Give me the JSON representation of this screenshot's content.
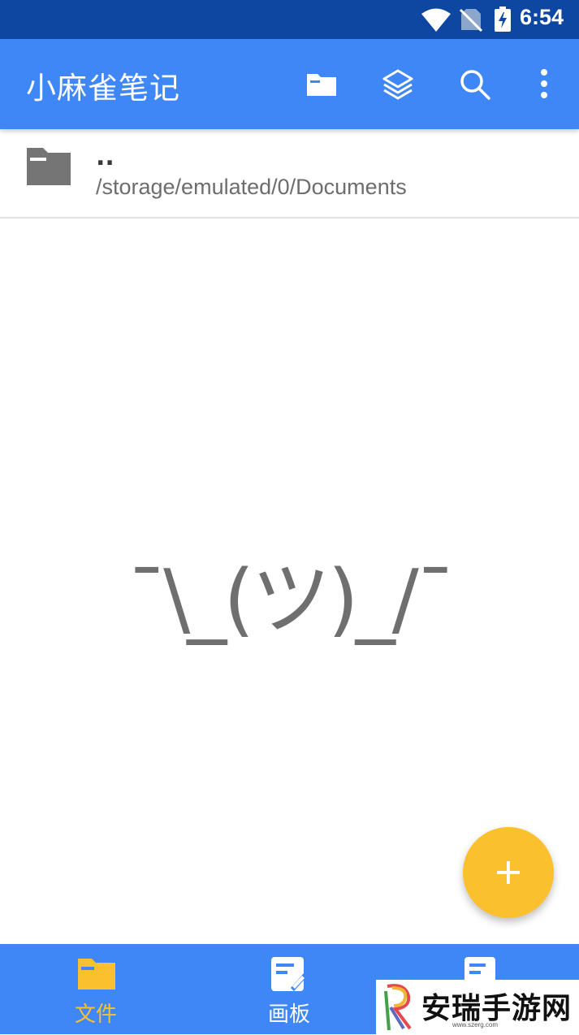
{
  "status_bar": {
    "time": "6:54",
    "icons": [
      "wifi-icon",
      "no-sim-icon",
      "battery-charging-icon"
    ]
  },
  "app_bar": {
    "title": "小麻雀笔记",
    "actions": [
      "folder-icon",
      "layers-icon",
      "search-icon",
      "more-vert-icon"
    ],
    "color": "#3f86f6"
  },
  "file_list": {
    "items": [
      {
        "name": "..",
        "path": "/storage/emulated/0/Documents",
        "icon": "folder-icon"
      }
    ]
  },
  "empty_state": {
    "text": "¯\\_(ツ)_/¯"
  },
  "fab": {
    "icon": "plus-icon",
    "color": "#fbc02d"
  },
  "bottom_nav": {
    "items": [
      {
        "label": "文件",
        "icon": "folder-icon",
        "active": true
      },
      {
        "label": "画板",
        "icon": "note-edit-icon",
        "active": false
      },
      {
        "label": "",
        "icon": "note-icon",
        "active": false
      }
    ],
    "active_color": "#fbc02d"
  },
  "watermark": {
    "text": "安瑞手游网",
    "url": "www.szerg.com"
  }
}
